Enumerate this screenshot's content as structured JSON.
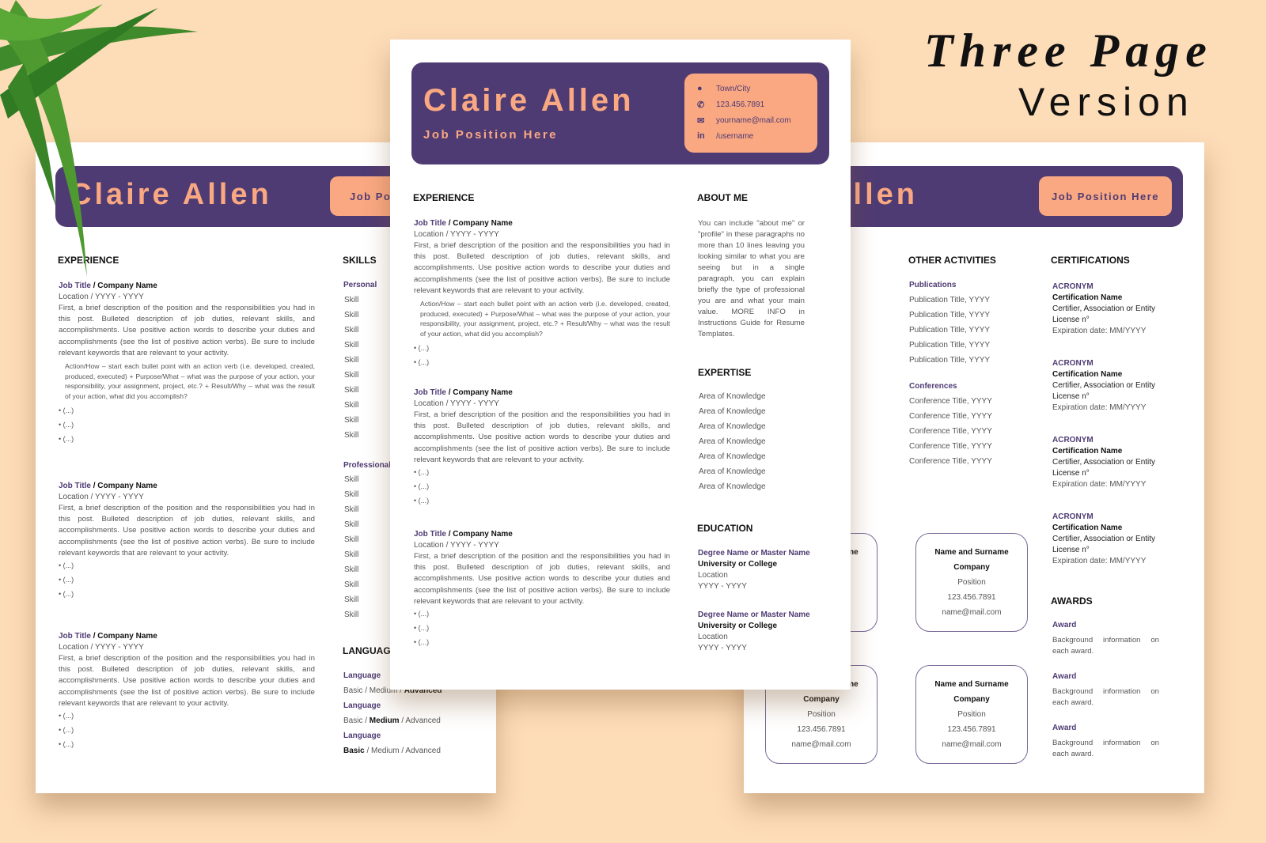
{
  "mockup": {
    "title_line1": "Three Page",
    "title_line2": "Version"
  },
  "colors": {
    "background": "#fddcb8",
    "primary": "#4f3b73",
    "accent": "#f9a882"
  },
  "resume": {
    "name": "Claire Allen",
    "job_position": "Job Position Here",
    "job_position_cut": "Job Pos",
    "name_cut": "re Allen",
    "contact": [
      {
        "icon": "location-pin-icon",
        "text": "Town/City"
      },
      {
        "icon": "phone-icon",
        "text": "123.456.7891"
      },
      {
        "icon": "envelope-icon",
        "text": "yourname@mail.com"
      },
      {
        "icon": "linkedin-icon",
        "text": "/username"
      }
    ],
    "sections": {
      "experience": "EXPERIENCE",
      "about": "ABOUT ME",
      "expertise": "EXPERTISE",
      "education": "EDUCATION",
      "skills": "SKILLS",
      "languages": "LANGUAGES",
      "other": "OTHER ACTIVITIES",
      "certifications": "CERTIFICATIONS",
      "awards": "AWARDS"
    },
    "job": {
      "title": "Job Title",
      "company": " / Company Name",
      "location": "Location / YYYY - YYYY",
      "description": "First, a brief description of the position and the responsibilities you had in this post. Bulleted description of job duties, relevant skills, and accomplishments. Use positive action words to describe your duties and accomplishments (see the list of positive action verbs). Be sure to include relevant keywords that are relevant to your activity.",
      "bullet": "Action/How – start each bullet point with an action verb (i.e. developed, created, produced, executed) + Purpose/What – what was the purpose of your action, your responsibility, your assignment, project, etc.? + Result/Why – what was the result of your action, what did you accomplish?",
      "ellipsis": "(...)"
    },
    "about": "You can include \"about me\" or \"profile\" in these paragraphs no more than 10 lines leaving you looking similar to what you are seeing but in a single paragraph, you can explain briefly the type of professional you are and what your main value. MORE INFO in Instructions Guide for Resume Templates.",
    "expertise_item": "Area of Knowledge",
    "education": {
      "degree": "Degree Name or Master Name",
      "school": "University or College",
      "location": "Location",
      "years": "YYYY - YYYY"
    },
    "skills": {
      "personal": "Personal",
      "professional": "Professional",
      "item": "Skill"
    },
    "languages": [
      {
        "name": "Language",
        "levels": [
          "Basic",
          "Medium",
          "Advanced"
        ],
        "selected": 2
      },
      {
        "name": "Language",
        "levels": [
          "Basic",
          "Medium",
          "Advanced"
        ],
        "selected": 1
      },
      {
        "name": "Language",
        "levels": [
          "Basic",
          "Medium",
          "Advanced"
        ],
        "selected": 0
      }
    ],
    "other": {
      "publications": "Publications",
      "publication_item": "Publication Title, YYYY",
      "conferences": "Conferences",
      "conference_item": "Conference Title, YYYY"
    },
    "certification": {
      "acronym": "ACRONYM",
      "name": "Certification Name",
      "certifier": "Certifier, Association or Entity",
      "license": "License n°",
      "expiration": "Expiration date: MM/YYYY"
    },
    "award": {
      "title": "Award",
      "text": "Background information on each award."
    },
    "reference": {
      "name": "Name and Surname",
      "company": "Company",
      "position": "Position",
      "phone": "123.456.7891",
      "email": "name@mail.com"
    }
  }
}
